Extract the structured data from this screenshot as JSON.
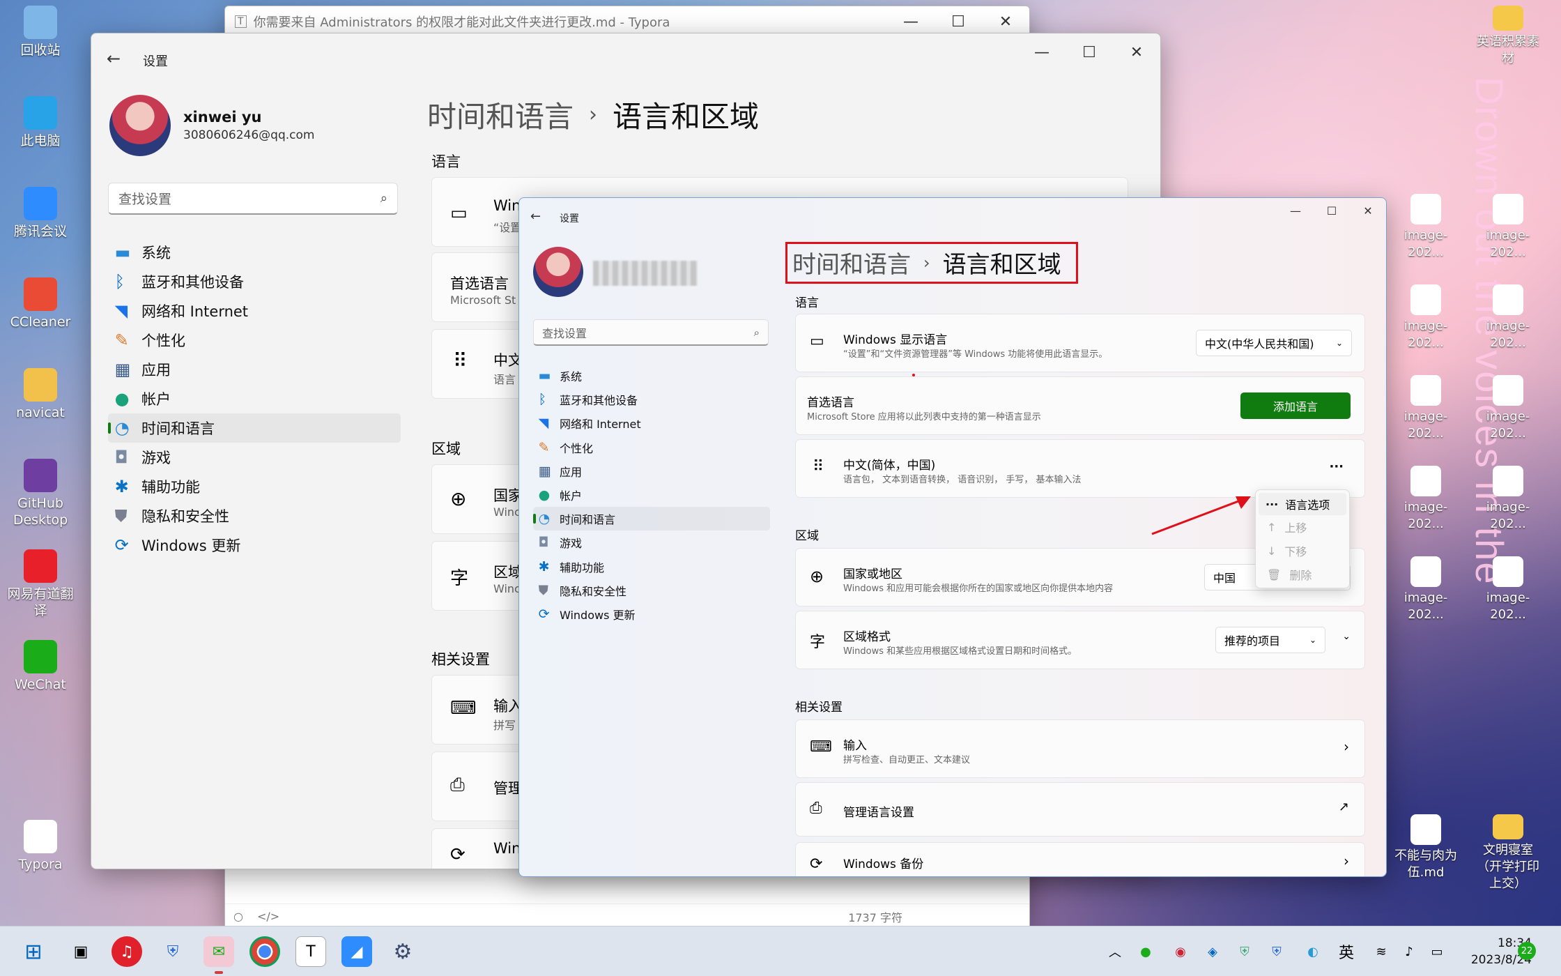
{
  "desktop": {
    "left_icons": [
      {
        "label": "回收站",
        "name": "recycle-bin-icon"
      },
      {
        "label": "此电脑",
        "name": "this-pc-icon"
      },
      {
        "label": "腾讯会议",
        "name": "tencent-meeting-icon"
      },
      {
        "label": "CCleaner",
        "name": "ccleaner-icon"
      },
      {
        "label": "navicat",
        "name": "navicat-icon"
      },
      {
        "label": "GitHub Desktop",
        "name": "github-desktop-icon"
      },
      {
        "label": "网易有道翻译",
        "name": "youdao-icon"
      },
      {
        "label": "WeChat",
        "name": "wechat-icon"
      },
      {
        "label": "Typora",
        "name": "typora-icon"
      }
    ],
    "right_icons": [
      {
        "label": "英语积累素材",
        "name": "folder-icon"
      },
      {
        "label": "image-202...",
        "name": "image-file-icon"
      },
      {
        "label": "image-202...",
        "name": "image-file-icon"
      },
      {
        "label": "image-202...",
        "name": "image-file-icon"
      },
      {
        "label": "image-202...",
        "name": "image-file-icon"
      },
      {
        "label": "image-202...",
        "name": "image-file-icon"
      },
      {
        "label": "image-202...",
        "name": "image-file-icon"
      },
      {
        "label": "image-202...",
        "name": "image-file-icon"
      },
      {
        "label": "image-202...",
        "name": "image-file-icon"
      },
      {
        "label": "image-202...",
        "name": "image-file-icon"
      },
      {
        "label": "image-202...",
        "name": "image-file-icon"
      },
      {
        "label": "不能与肉为伍.md",
        "name": "markdown-file-icon"
      },
      {
        "label": "文明寝室（开学打印上交）",
        "name": "folder-icon"
      }
    ],
    "wallpaper_text": "Drown out the voices in the air"
  },
  "typora": {
    "title": "你需要来自 Administrators 的权限才能对此文件夹进行更改.md - Typora",
    "word_count": "1737 字符"
  },
  "back_window": {
    "title": "设置",
    "user_name": "xinwei yu",
    "user_email": "3080606246@qq.com",
    "search_placeholder": "查找设置",
    "breadcrumb_parent": "时间和语言",
    "breadcrumb_sep": "›",
    "breadcrumb_current": "语言和区域",
    "section_language": "语言",
    "section_region": "区域",
    "section_related": "相关设置",
    "rows": [
      "Win",
      "“设置",
      "首选语言",
      "Microsoft St",
      "中文",
      "语言",
      "国家",
      "Winc",
      "区域",
      "Winc",
      "输入",
      "拼写",
      "管理",
      "Win"
    ]
  },
  "nav": [
    {
      "label": "系统",
      "icon": "system-icon"
    },
    {
      "label": "蓝牙和其他设备",
      "icon": "bluetooth-icon"
    },
    {
      "label": "网络和 Internet",
      "icon": "wifi-icon"
    },
    {
      "label": "个性化",
      "icon": "brush-icon"
    },
    {
      "label": "应用",
      "icon": "apps-icon"
    },
    {
      "label": "帐户",
      "icon": "account-icon"
    },
    {
      "label": "时间和语言",
      "icon": "globe-clock-icon"
    },
    {
      "label": "游戏",
      "icon": "gamepad-icon"
    },
    {
      "label": "辅助功能",
      "icon": "accessibility-icon"
    },
    {
      "label": "隐私和安全性",
      "icon": "shield-icon"
    },
    {
      "label": "Windows 更新",
      "icon": "update-icon"
    }
  ],
  "front_window": {
    "title": "设置",
    "search_placeholder": "查找设置",
    "breadcrumb_parent": "时间和语言",
    "breadcrumb_sep": "›",
    "breadcrumb_current": "语言和区域",
    "section_language": "语言",
    "display_lang_title": "Windows 显示语言",
    "display_lang_desc": "“设置”和“文件资源管理器”等 Windows 功能将使用此语言显示。",
    "display_lang_value": "中文(中华人民共和国)",
    "pref_lang_title": "首选语言",
    "pref_lang_desc": "Microsoft Store 应用将以此列表中支持的第一种语言显示",
    "add_lang_button": "添加语言",
    "lang_item_title": "中文(简体，中国)",
    "lang_item_desc": "语言包， 文本到语音转换， 语音识别， 手写， 基本输入法",
    "more_glyph": "···",
    "context_menu": [
      "语言选项",
      "上移",
      "下移",
      "删除"
    ],
    "section_region": "区域",
    "country_title": "国家或地区",
    "country_desc": "Windows 和应用可能会根据你所在的国家或地区向你提供本地内容",
    "country_value": "中国",
    "format_title": "区域格式",
    "format_desc": "Windows 和某些应用根据区域格式设置日期和时间格式。",
    "format_value": "推荐的项目",
    "section_related": "相关设置",
    "input_title": "输入",
    "input_desc": "拼写检查、自动更正、文本建议",
    "manage_title": "管理语言设置",
    "backup_title": "Windows 备份"
  },
  "taskbar": {
    "time": "18:34",
    "date": "2023/8/24",
    "ime": "英",
    "badge": "22"
  },
  "accent": {
    "green": "#107c10",
    "red": "#e0101a",
    "blue": "#0067c0"
  }
}
